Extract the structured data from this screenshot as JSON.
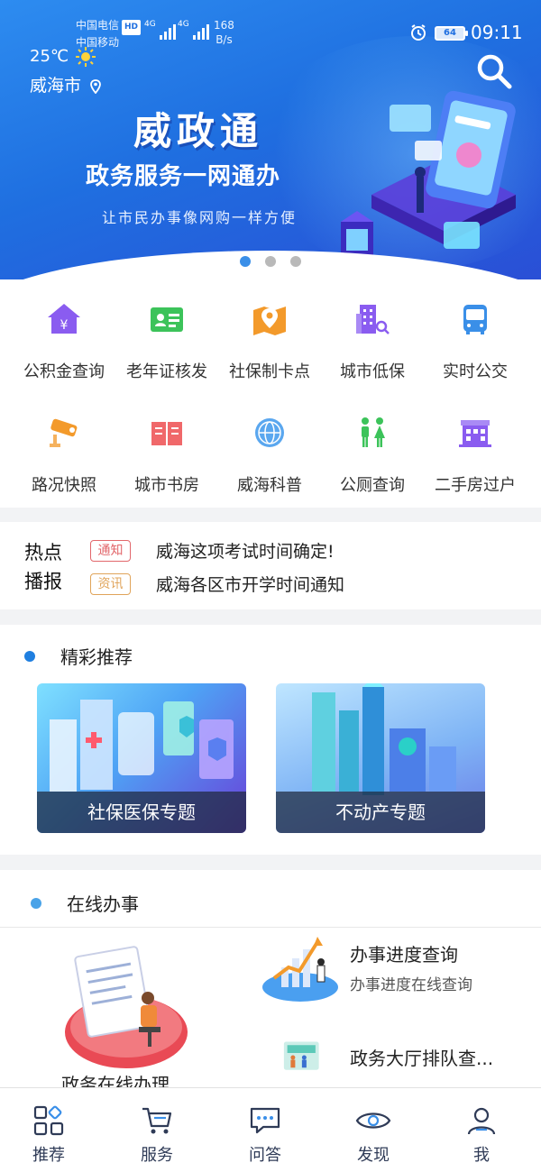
{
  "status_bar": {
    "carrier_1": "中国电信",
    "hd": "HD",
    "carrier_2": "中国移动",
    "network_1": "4G",
    "network_2": "4G",
    "speed_value": "168",
    "speed_unit": "B/s",
    "battery": "64",
    "time": "09:11"
  },
  "header": {
    "temperature": "25℃",
    "city": "威海市",
    "search_icon": "search-icon"
  },
  "banner": {
    "title": "威政通",
    "subtitle": "政务服务一网通办",
    "tagline": "让市民办事像网购一样方便",
    "dots": 3,
    "active_dot": 0
  },
  "services": [
    {
      "label": "公积金查询",
      "icon": "house-yuan-icon",
      "color": "#8a5cf0"
    },
    {
      "label": "老年证核发",
      "icon": "id-card-icon",
      "color": "#3cc35a"
    },
    {
      "label": "社保制卡点",
      "icon": "map-pin-icon",
      "color": "#f39a2b"
    },
    {
      "label": "城市低保",
      "icon": "building-search-icon",
      "color": "#8a5cf0"
    },
    {
      "label": "实时公交",
      "icon": "bus-icon",
      "color": "#3a8fe8"
    },
    {
      "label": "路况快照",
      "icon": "camera-icon",
      "color": "#f39a2b"
    },
    {
      "label": "城市书房",
      "icon": "book-icon",
      "color": "#f0686a"
    },
    {
      "label": "威海科普",
      "icon": "globe-icon",
      "color": "#3a8fe8"
    },
    {
      "label": "公厕查询",
      "icon": "toilet-icon",
      "color": "#3cc35a"
    },
    {
      "label": "二手房过户",
      "icon": "house-transfer-icon",
      "color": "#8a5cf0"
    }
  ],
  "news": {
    "label_line1": "热点",
    "label_line2": "播报",
    "items": [
      {
        "tag": "通知",
        "text": "威海这项考试时间确定!"
      },
      {
        "tag": "资讯",
        "text": "威海各区市开学时间通知"
      }
    ]
  },
  "recommend": {
    "title": "精彩推荐",
    "cards": [
      {
        "caption": "社保医保专题"
      },
      {
        "caption": "不动产专题"
      }
    ]
  },
  "online": {
    "title": "在线办事",
    "main_item": "政务在线办理",
    "items": [
      {
        "title": "办事进度查询",
        "subtitle": "办事进度在线查询"
      },
      {
        "title": "政务大厅排队查...",
        "subtitle": ""
      }
    ]
  },
  "tabbar": [
    {
      "label": "推荐",
      "icon": "grid-icon"
    },
    {
      "label": "服务",
      "icon": "cart-icon"
    },
    {
      "label": "问答",
      "icon": "chat-icon"
    },
    {
      "label": "发现",
      "icon": "eye-icon"
    },
    {
      "label": "我",
      "icon": "user-icon"
    }
  ],
  "colors": {
    "banner_blue": "#1f6fe0",
    "accent_blue": "#3a8fe8",
    "tab_text": "#2f3b57"
  }
}
